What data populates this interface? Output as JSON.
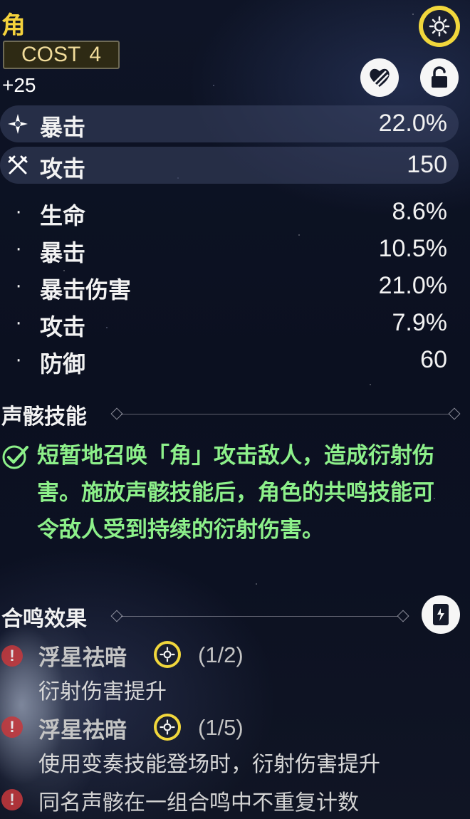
{
  "echo": {
    "name": "角",
    "cost_label": "COST",
    "cost_value": "4",
    "level": "+25"
  },
  "top_icons": {
    "sonata": "sonata-emblem-icon",
    "discard": "discard-heart-icon",
    "lock": "unlock-icon"
  },
  "main_stats": [
    {
      "icon": "crit-star-icon",
      "label": "暴击",
      "value": "22.0%"
    },
    {
      "icon": "crossed-swords-icon",
      "label": "攻击",
      "value": "150"
    }
  ],
  "sub_stats": [
    {
      "label": "生命",
      "value": "8.6%"
    },
    {
      "label": "暴击",
      "value": "10.5%"
    },
    {
      "label": "暴击伤害",
      "value": "21.0%"
    },
    {
      "label": "攻击",
      "value": "7.9%"
    },
    {
      "label": "防御",
      "value": "60"
    }
  ],
  "skill_section": {
    "title": "声骸技能",
    "description": "短暂地召唤「角」攻击敌人，造成衍射伤害。施放声骸技能后，角色的共鸣技能可令敌人受到持续的衍射伤害。"
  },
  "sonata_section": {
    "title": "合鸣效果",
    "effects": [
      {
        "name": "浮星祛暗",
        "count": "(1/2)",
        "description": "衍射伤害提升"
      },
      {
        "name": "浮星祛暗",
        "count": "(1/5)",
        "description": "使用变奏技能登场时，衍射伤害提升"
      }
    ],
    "note": "同名声骸在一组合鸣中不重复计数"
  },
  "colors": {
    "title_gold": "#f4d23c",
    "skill_green": "#8df08a",
    "warn_red": "#c8383c"
  }
}
